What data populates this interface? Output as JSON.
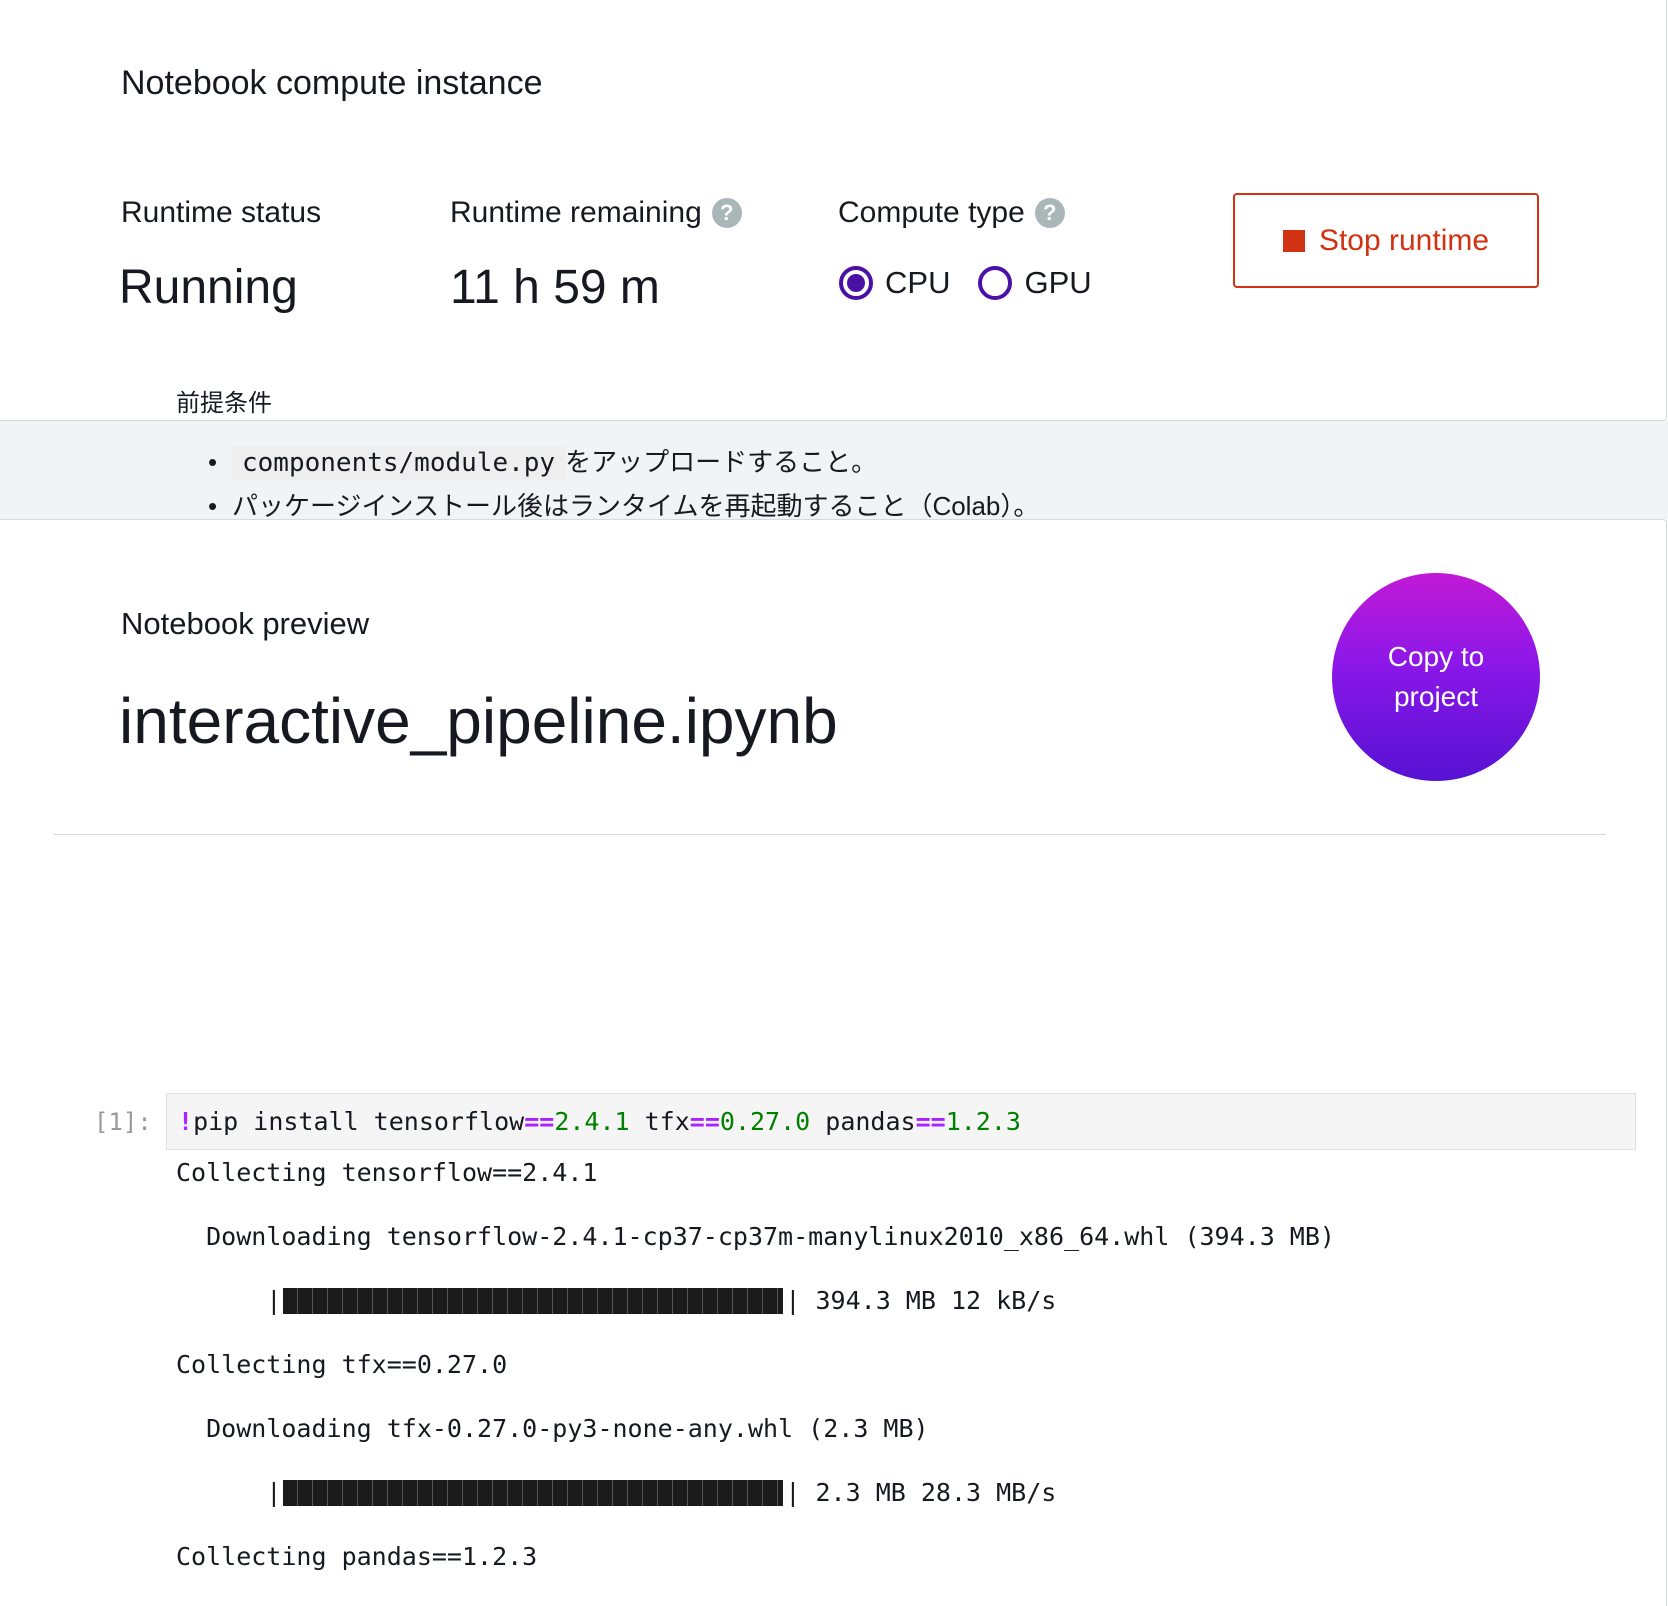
{
  "compute": {
    "title": "Notebook compute instance",
    "runtime_status_label": "Runtime status",
    "runtime_status_value": "Running",
    "runtime_remaining_label": "Runtime remaining",
    "runtime_remaining_value": "11 h 59 m",
    "compute_type_label": "Compute type",
    "help_glyph": "?",
    "compute_options": [
      "CPU",
      "GPU"
    ],
    "compute_selected": "CPU",
    "stop_button_label": "Stop runtime"
  },
  "preview": {
    "label": "Notebook preview",
    "notebook_name": "interactive_pipeline.ipynb",
    "copy_button_label": "Copy to project"
  },
  "notebook": {
    "heading": "前提条件",
    "bullets": [
      {
        "code": "components/module.py",
        "text": "をアップロードすること。"
      },
      {
        "code": "",
        "text": "パッケージインストール後はランタイムを再起動すること（Colab）。"
      }
    ],
    "cell_prompt": "[1]:",
    "cell_tokens": [
      {
        "t": "!",
        "k": "op"
      },
      {
        "t": "pip install tensorflow",
        "k": "txt"
      },
      {
        "t": "==",
        "k": "op"
      },
      {
        "t": "2.4.1",
        "k": "num"
      },
      {
        "t": " tfx",
        "k": "txt"
      },
      {
        "t": "==",
        "k": "op"
      },
      {
        "t": "0.27.0",
        "k": "num"
      },
      {
        "t": " pandas",
        "k": "txt"
      },
      {
        "t": "==",
        "k": "op"
      },
      {
        "t": "1.2.3",
        "k": "num"
      }
    ],
    "output": [
      {
        "kind": "text",
        "indent": 0,
        "text": "Collecting tensorflow==2.4.1"
      },
      {
        "kind": "text",
        "indent": 2,
        "text": "Downloading tensorflow-2.4.1-cp37-cp37m-manylinux2010_x86_64.whl (394.3 MB)"
      },
      {
        "kind": "progress",
        "indent": 6,
        "progress": 1.0,
        "text": " 394.3 MB 12 kB/s"
      },
      {
        "kind": "text",
        "indent": 0,
        "text": "Collecting tfx==0.27.0"
      },
      {
        "kind": "text",
        "indent": 2,
        "text": "Downloading tfx-0.27.0-py3-none-any.whl (2.3 MB)"
      },
      {
        "kind": "progress",
        "indent": 6,
        "progress": 1.0,
        "text": " 2.3 MB 28.3 MB/s"
      },
      {
        "kind": "text",
        "indent": 0,
        "text": "Collecting pandas==1.2.3"
      }
    ]
  },
  "colors": {
    "accent_purple": "#4b10a6",
    "stop_red": "#d13212",
    "copy_gradient_top": "#c21ad6",
    "copy_gradient_bottom": "#5612d2"
  }
}
